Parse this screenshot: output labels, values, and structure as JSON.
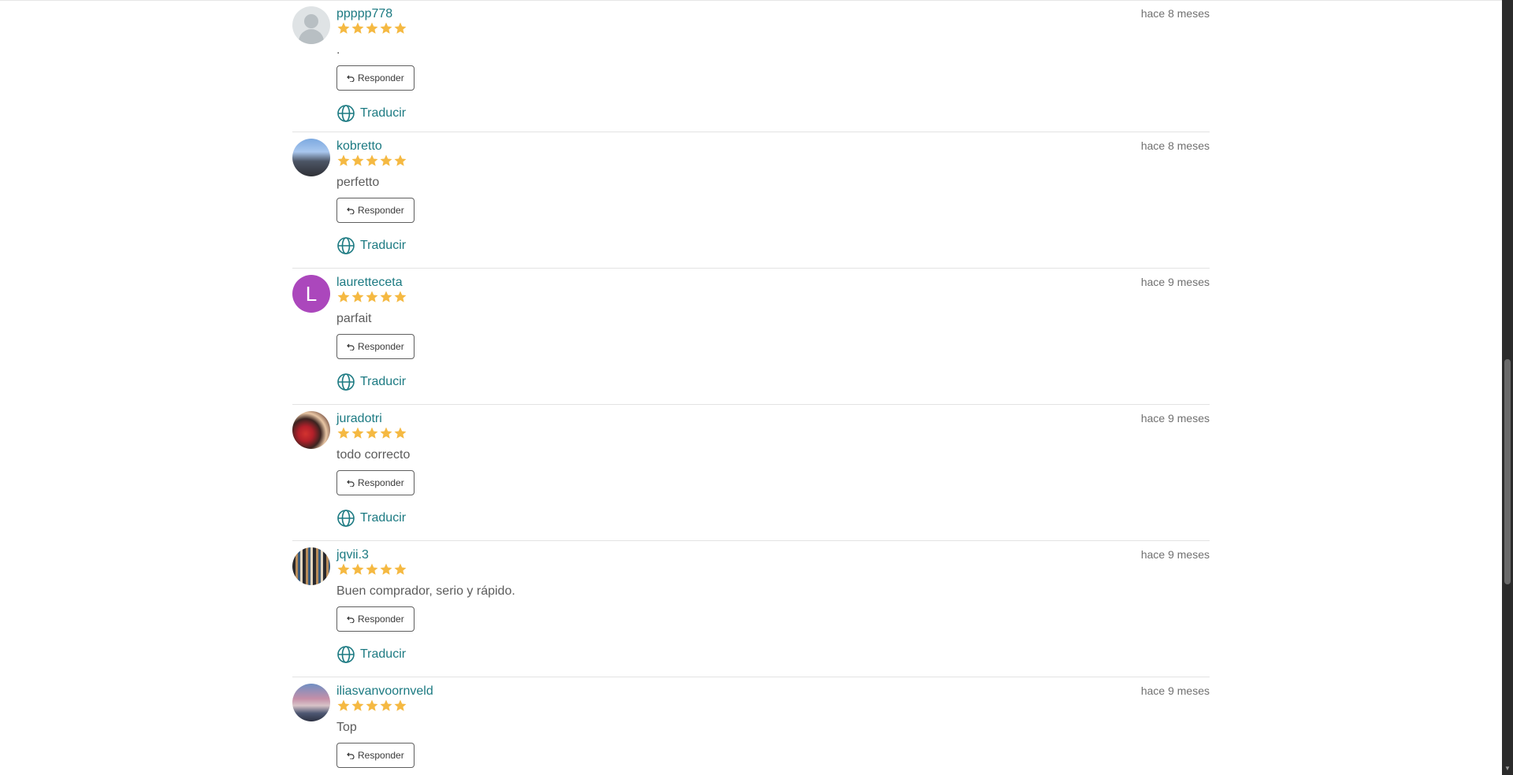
{
  "reviews": [
    {
      "username": "ppppp778",
      "time": "hace 8 meses",
      "rating": 5,
      "comment": ".",
      "reply_label": "Responder",
      "translate_label": "Traducir",
      "avatar": "placeholder"
    },
    {
      "username": "kobretto",
      "time": "hace 8 meses",
      "rating": 5,
      "comment": "perfetto",
      "reply_label": "Responder",
      "translate_label": "Traducir",
      "avatar": "photo"
    },
    {
      "username": "lauretteceta",
      "time": "hace 9 meses",
      "rating": 5,
      "comment": "parfait",
      "reply_label": "Responder",
      "translate_label": "Traducir",
      "avatar": "letter",
      "avatar_letter": "L"
    },
    {
      "username": "juradotri",
      "time": "hace 9 meses",
      "rating": 5,
      "comment": "todo correcto",
      "reply_label": "Responder",
      "translate_label": "Traducir",
      "avatar": "photo"
    },
    {
      "username": "jqvii.3",
      "time": "hace 9 meses",
      "rating": 5,
      "comment": "Buen comprador, serio y rápido.",
      "reply_label": "Responder",
      "translate_label": "Traducir",
      "avatar": "photo"
    },
    {
      "username": "iliasvanvoornveld",
      "time": "hace 9 meses",
      "rating": 5,
      "comment": "Top",
      "reply_label": "Responder",
      "avatar": "photo"
    }
  ],
  "colors": {
    "accent": "#1c7a82",
    "star": "#f5b942",
    "letter_avatar": "#ab47bc"
  },
  "icons": {
    "reply": "undo-arrow-icon",
    "translate": "globe-icon",
    "rating": "star-icon"
  }
}
